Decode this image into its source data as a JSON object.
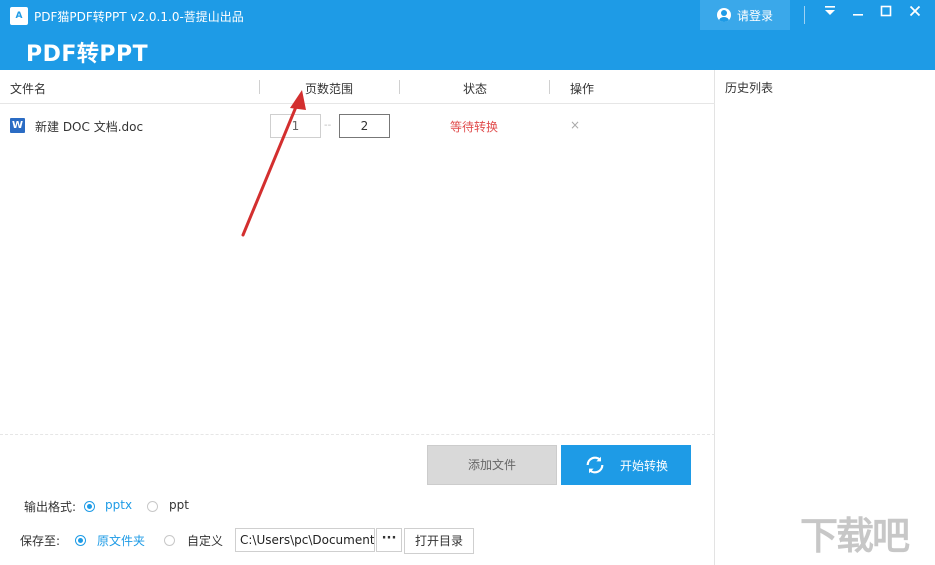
{
  "window": {
    "title": "PDF猫PDF转PPT v2.0.1.0-菩提山出品",
    "app_icon": "A",
    "big_title": "PDF转PPT",
    "login_label": "请登录",
    "icons": {
      "user": "user-icon",
      "dropdown": "dropdown-icon",
      "minimize": "minimize-icon",
      "maximize": "maximize-icon",
      "close": "close-icon"
    }
  },
  "table": {
    "headers": [
      "文件名",
      "页数范围",
      "状态",
      "操作"
    ],
    "rows": [
      {
        "file_icon": "W",
        "file_name": "新建 DOC 文档.doc",
        "page_from": "1",
        "page_to": "2",
        "status": "等待转换",
        "action_icon": "×"
      }
    ]
  },
  "buttons": {
    "add_file": "添加文件",
    "start_convert": "开始转换",
    "open_dir": "打开目录",
    "browse": "···"
  },
  "options": {
    "format_label": "输出格式:",
    "formats": [
      {
        "label": "pptx",
        "selected": true
      },
      {
        "label": "ppt",
        "selected": false
      }
    ],
    "save_label": "保存至:",
    "save_targets": [
      {
        "label": "原文件夹",
        "selected": true
      },
      {
        "label": "自定义",
        "selected": false
      }
    ],
    "save_path": "C:\\Users\\pc\\Document"
  },
  "sidebar": {
    "title": "历史列表"
  },
  "watermark": "下载吧",
  "colors": {
    "accent": "#1e9be6",
    "status": "#e04c4c",
    "arrow": "#d32f2f"
  }
}
